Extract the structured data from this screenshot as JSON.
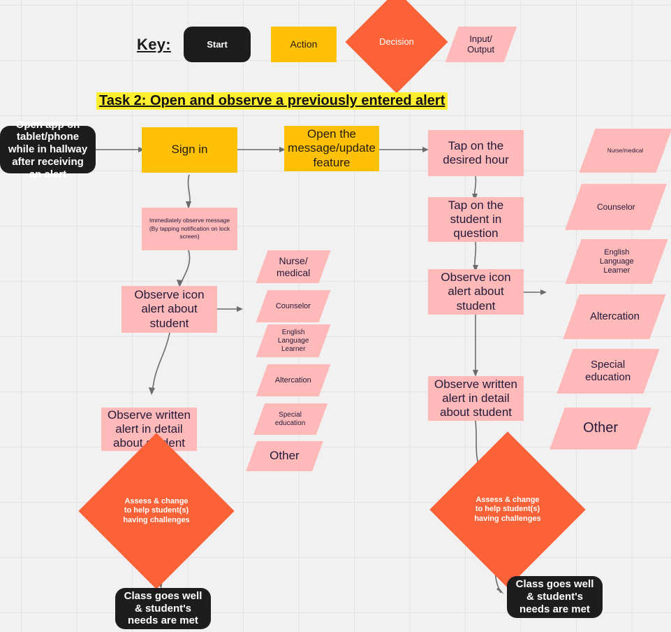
{
  "page": {
    "background": "#f1f1f1",
    "grid_color": "#e2e2e2"
  },
  "colors": {
    "terminator": "#1d1d1d",
    "action": "#FFC107",
    "process": "#FFB9B9",
    "decision": "#FB6237",
    "io": "#FFB9B9",
    "highlight": "#FFEE2E",
    "connector": "#6b6b6b"
  },
  "key": {
    "label": "Key:",
    "items": [
      {
        "type": "start",
        "label": "Start"
      },
      {
        "type": "action",
        "label": "Action"
      },
      {
        "type": "decision",
        "label": "Decision"
      },
      {
        "type": "io",
        "label": "Input/\nOutput"
      }
    ]
  },
  "title": "Task 2: Open and observe a previously entered alert",
  "flow": {
    "start": "Open app on tablet/phone while in hallway after receiving an alert",
    "sign_in": "Sign in",
    "open_feature": "Open the message/update feature",
    "immediate_observe": "Immediately observe message (By tapping notification on lock screen)",
    "left_observe_icon": "Observe icon alert about student",
    "left_observe_written": "Observe written alert in detail about student",
    "left_decision": "Assess & change to help student(s) having challenges",
    "left_end": "Class goes well & student's needs are met",
    "tap_hour": "Tap on the desired hour",
    "tap_student": "Tap on the student in question",
    "right_observe_icon": "Observe icon alert about student",
    "right_observe_written": "Observe written alert in detail about student",
    "right_decision": "Assess & change to help student(s) having challenges",
    "right_end": "Class goes well & student's needs are met"
  },
  "alert_types_left": [
    "Nurse/\nmedical",
    "Counselor",
    "English\nLanguage\nLearner",
    "Altercation",
    "Special\neducation",
    "Other"
  ],
  "alert_types_right": [
    "Nurse/medical",
    "Counselor",
    "English\nLanguage\nLearner",
    "Altercation",
    "Special\neducation",
    "Other"
  ]
}
